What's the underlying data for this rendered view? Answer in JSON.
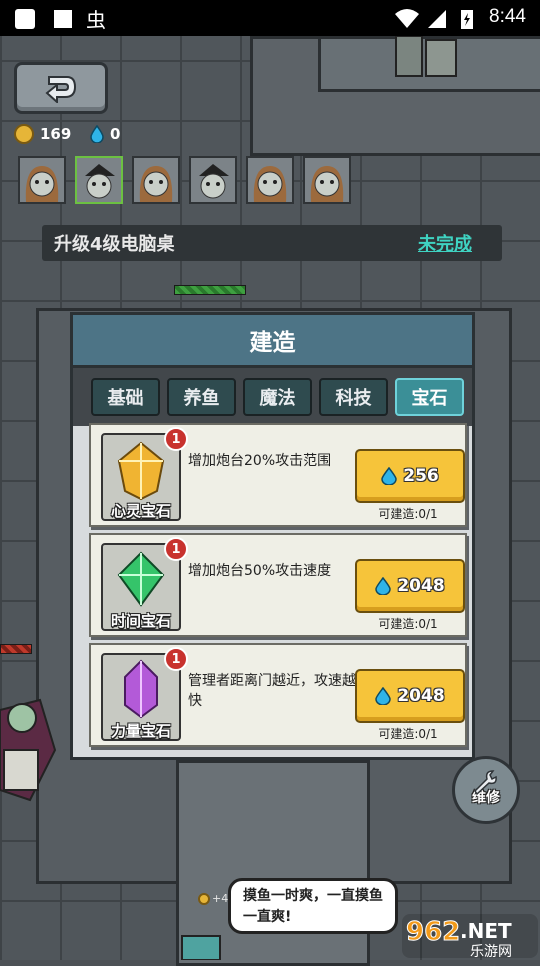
{
  "status_bar": {
    "time": "8:44"
  },
  "resources": {
    "coins": "169",
    "gems": "0"
  },
  "task": {
    "text": "升级4级电脑桌",
    "status": "未完成"
  },
  "build_panel": {
    "title": "建造",
    "tabs": [
      {
        "label": "基础",
        "active": false
      },
      {
        "label": "养鱼",
        "active": false
      },
      {
        "label": "魔法",
        "active": false
      },
      {
        "label": "科技",
        "active": false
      },
      {
        "label": "宝石",
        "active": true
      }
    ],
    "items": [
      {
        "name": "心灵宝石",
        "badge": "1",
        "desc": "增加炮台20%攻击范围",
        "cost": "256",
        "available": "可建造:0/1",
        "color": "#f0b432"
      },
      {
        "name": "时间宝石",
        "badge": "1",
        "desc": "增加炮台50%攻击速度",
        "cost": "2048",
        "available": "可建造:0/1",
        "color": "#35c46a"
      },
      {
        "name": "力量宝石",
        "badge": "1",
        "desc": "管理者距离门越近，攻速越快",
        "cost": "2048",
        "available": "可建造:0/1",
        "color": "#b35ad8"
      }
    ]
  },
  "repair_button": {
    "label": "维修"
  },
  "speech_bubble": {
    "text": "摸鱼一时爽，一直摸鱼一直爽!"
  },
  "small_reward": {
    "text": "+4"
  },
  "watermark": {
    "brand": "962",
    "net": ".NET",
    "site": "乐游网"
  },
  "colors": {
    "accent": "#3fd3c2",
    "panel_header": "#4d7486",
    "tab_active": "#3b8f97",
    "button": "#f6c43a",
    "badge": "#c8322d"
  }
}
